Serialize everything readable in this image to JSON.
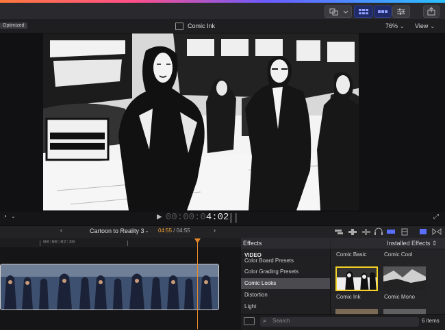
{
  "viewer": {
    "badge": "Optimized",
    "clip_title": "Comic Ink",
    "zoom": "76%",
    "view_label": "View"
  },
  "playback": {
    "timecode_dim": "00:00:0",
    "timecode_bright": "4:02"
  },
  "timeline": {
    "project_name": "Cartoon to Reality 3",
    "current": "04:55",
    "separator": "/",
    "total": "04:55",
    "ruler_label": "00:00:02:30"
  },
  "effects": {
    "title": "Effects",
    "installed_label": "Installed Effects",
    "categories": [
      {
        "label": "VIDEO"
      },
      {
        "label": "Color Board Presets"
      },
      {
        "label": "Color Grading Presets"
      },
      {
        "label": "Comic Looks"
      },
      {
        "label": "Distortion"
      },
      {
        "label": "Light"
      }
    ],
    "thumbnails": [
      {
        "label": "Comic Basic"
      },
      {
        "label": "Comic Cool"
      },
      {
        "label": "Comic Ink"
      },
      {
        "label": "Comic Mono"
      }
    ],
    "search_placeholder": "Search",
    "count": "6 items"
  },
  "colors": {
    "accent": "#e8892a",
    "selection": "#f5d224",
    "active_button": "#1f2a66"
  }
}
